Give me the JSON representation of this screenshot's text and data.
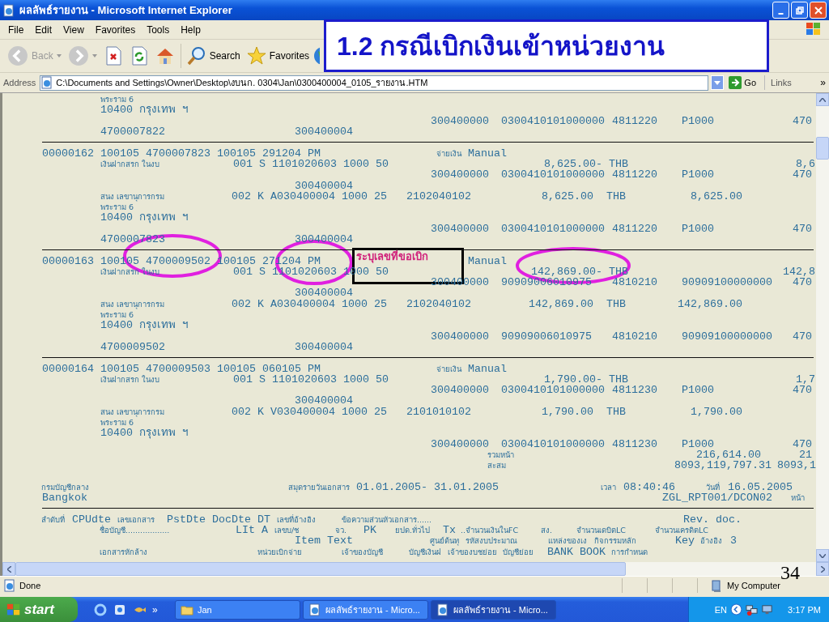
{
  "window": {
    "title": "ผลลัพธ์รายงาน - Microsoft Internet Explorer"
  },
  "menu": [
    "File",
    "Edit",
    "View",
    "Favorites",
    "Tools",
    "Help"
  ],
  "toolbar": {
    "back": {
      "label": "Back",
      "disabled": true
    },
    "forward": {
      "disabled": true
    },
    "search": "Search",
    "favorites": "Favorites"
  },
  "address": {
    "label": "Address",
    "value": "C:\\Documents and Settings\\Owner\\Desktop\\งบนก. 0304\\Jan\\0300400004_0105_รายงาน.HTM",
    "go": "Go",
    "links": "Links",
    "links_more": "»"
  },
  "slide": {
    "title": "1.2 กรณีเบิกเงินเข้าหน่วยงาน",
    "callout": "ระบุเลขที่ขอเบิก",
    "page_number": "34"
  },
  "report": {
    "lines": [
      {
        "kind": "text",
        "cells": [
          "พระราม 6"
        ]
      },
      {
        "kind": "text",
        "cells": [
          "10400 กรุงเทพ ฯ"
        ]
      },
      {
        "kind": "text",
        "cells": [
          "300400000",
          "0300410101000000",
          "4811220",
          "P1000",
          "470"
        ]
      },
      {
        "kind": "text",
        "cells": [
          "4700007822",
          "300400004"
        ]
      },
      {
        "kind": "rule"
      },
      {
        "kind": "text",
        "cells": [
          "00000162 100105 4700007823 100105 291204 PM",
          "จ่ายเงิน",
          "Manual"
        ]
      },
      {
        "kind": "text",
        "cells": [
          "เงินฝากสรก  ในงบ",
          "001 S 1101020603 1000 50",
          "8,625.00- THB",
          "8,6"
        ]
      },
      {
        "kind": "text",
        "cells": [
          "300400000",
          "0300410101000000",
          "4811220",
          "P1000",
          "470"
        ]
      },
      {
        "kind": "text",
        "cells": [
          "300400004"
        ]
      },
      {
        "kind": "text",
        "cells": [
          "สนง  เลขานุการกรม",
          "002 K A030400004 1000 25",
          "2102040102",
          "8,625.00",
          "THB",
          "8,625.00"
        ]
      },
      {
        "kind": "text",
        "cells": [
          "พระราม 6"
        ]
      },
      {
        "kind": "text",
        "cells": [
          "10400 กรุงเทพ ฯ"
        ]
      },
      {
        "kind": "text",
        "cells": [
          "300400000",
          "0300410101000000",
          "4811220",
          "P1000",
          "470"
        ]
      },
      {
        "kind": "text",
        "cells": [
          "4700007823",
          "300400004"
        ]
      },
      {
        "kind": "rule"
      },
      {
        "kind": "text",
        "cells": [
          "00000163 100105 4700009502 100105 271204 PM",
          "Manual"
        ]
      },
      {
        "kind": "text",
        "cells": [
          "เงินฝากสรก  ในงบ",
          "001 S 1101020603 1000 50",
          "142,869.00- THB",
          "142,8"
        ]
      },
      {
        "kind": "text",
        "cells": [
          "300400000",
          "90909006010975",
          "4810210",
          "90909100000000",
          "470"
        ]
      },
      {
        "kind": "text",
        "cells": [
          "300400004"
        ]
      },
      {
        "kind": "text",
        "cells": [
          "สนง  เลขานุการกรม",
          "002 K A030400004 1000 25",
          "2102040102",
          "142,869.00",
          "THB",
          "142,869.00"
        ]
      },
      {
        "kind": "text",
        "cells": [
          "พระราม 6"
        ]
      },
      {
        "kind": "text",
        "cells": [
          "10400 กรุงเทพ ฯ"
        ]
      },
      {
        "kind": "text",
        "cells": [
          "300400000",
          "90909006010975",
          "4810210",
          "90909100000000",
          "470"
        ]
      },
      {
        "kind": "text",
        "cells": [
          "4700009502",
          "300400004"
        ]
      },
      {
        "kind": "rule"
      },
      {
        "kind": "text",
        "cells": [
          "00000164 100105 4700009503 100105 060105 PM",
          "จ่ายเงิน",
          "Manual"
        ]
      },
      {
        "kind": "text",
        "cells": [
          "เงินฝากสรก  ในงบ",
          "001 S 1101020603 1000 50",
          "1,790.00- THB",
          "1,7"
        ]
      },
      {
        "kind": "text",
        "cells": [
          "300400000",
          "0300410101000000",
          "4811230",
          "P1000",
          "470"
        ]
      },
      {
        "kind": "text",
        "cells": [
          "300400004"
        ]
      },
      {
        "kind": "text",
        "cells": [
          "สนง  เลขานุการกรม",
          "002 K V030400004 1000 25",
          "2101010102",
          "1,790.00",
          "THB",
          "1,790.00"
        ]
      },
      {
        "kind": "text",
        "cells": [
          "พระราม 6"
        ]
      },
      {
        "kind": "text",
        "cells": [
          "10400 กรุงเทพ ฯ"
        ]
      },
      {
        "kind": "text",
        "cells": [
          "300400000",
          "0300410101000000",
          "4811230",
          "P1000",
          "470"
        ]
      },
      {
        "kind": "text",
        "cells": [
          "รวมหน้า",
          "216,614.00",
          "21"
        ]
      },
      {
        "kind": "text",
        "cells": [
          "สะสม",
          "8093,119,797.31",
          "8093,1"
        ]
      },
      {
        "kind": "text",
        "cells": [
          "กรมบัญชีกลาง",
          "สมุดรายวันเอกสาร",
          "01.01.2005- 31.01.2005",
          "เวลา",
          "08:40:46",
          "วันที่",
          "16.05.2005"
        ]
      },
      {
        "kind": "text",
        "cells": [
          "Bangkok",
          "ZGL_RPT001/DCON02",
          "หน้า"
        ]
      },
      {
        "kind": "rule"
      },
      {
        "kind": "text",
        "cells": [
          "ลำดับที่",
          "CPUdte",
          "เลขเอกสาร",
          "PstDte DocDte DT",
          "เลขที่อ้างอิง",
          "ข้อความส่วนหัวเอกสาร......",
          "Rev. doc."
        ]
      },
      {
        "kind": "text",
        "cells": [
          "ชื่อบัญชี..................",
          "LIt A",
          "เลขบ/ช",
          "จว.",
          "PK",
          "ยปด.ทั่วไป",
          "Tx",
          "..จำนวนเงินในFC",
          "สง.",
          "จำนวนเดบิตLC",
          "จำนวนเครดิตLC"
        ]
      },
      {
        "kind": "text",
        "cells": [
          "Item Text",
          "ศูนย์ต้นทุ",
          "รหัสงบประมาณ",
          "แหล่งของเง",
          "กิจกรรมหลัก",
          "Key",
          "อ้างอิง",
          "3"
        ]
      },
      {
        "kind": "text",
        "cells": [
          "เอกสารหักล้าง",
          "หน่วยเบิกจ่าย",
          "เจ้าของบัญชี",
          "บัญชีเงินฝ",
          "เจ้าของบชย่อย",
          "บัญชีย่อย",
          "BANK BOOK",
          "การกำหนด"
        ]
      }
    ]
  },
  "status_bar": {
    "text": "Done",
    "zone": "My Computer"
  },
  "taskbar": {
    "start": "start",
    "quick_more": "»",
    "tasks": [
      {
        "label": "Jan",
        "kind": "folder",
        "selected": false
      },
      {
        "label": "ผลลัพธ์รายงาน - Micro...",
        "kind": "browser",
        "selected": false
      },
      {
        "label": "ผลลัพธ์รายงาน - Micro...",
        "kind": "browser",
        "selected": true
      }
    ],
    "language": "EN",
    "clock": "3:17 PM"
  }
}
